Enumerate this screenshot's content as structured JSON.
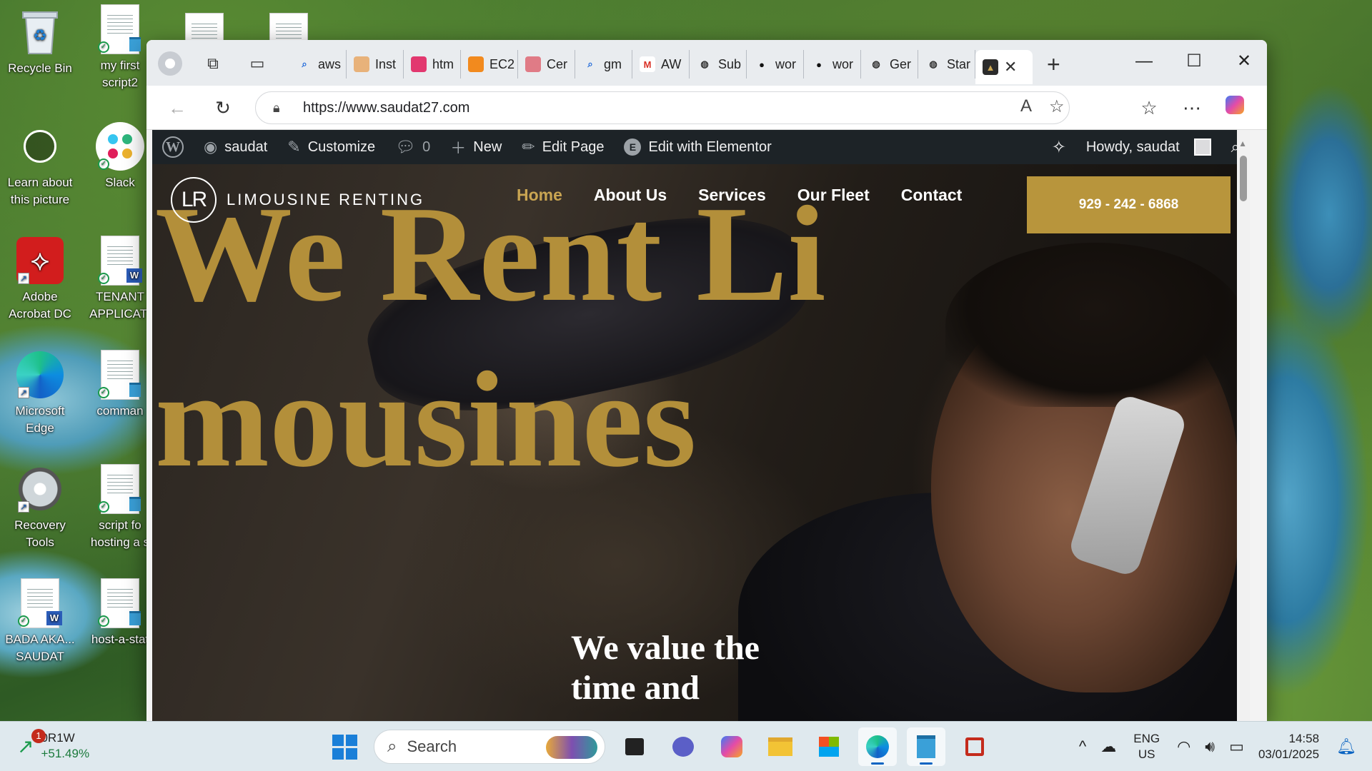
{
  "desktop": {
    "icons": [
      {
        "label": "Recycle Bin"
      },
      {
        "label": "my first\nscript2"
      },
      {
        "label": "Learn about\nthis picture"
      },
      {
        "label": "Slack"
      },
      {
        "label": "Adobe\nAcrobat DC"
      },
      {
        "label": "TENANT\nAPPLICATI"
      },
      {
        "label": "Microsoft\nEdge"
      },
      {
        "label": "comman"
      },
      {
        "label": "Recovery\nTools"
      },
      {
        "label": "script fo\nhosting a s"
      },
      {
        "label": "BADA AKA...\nSAUDAT"
      },
      {
        "label": "host-a-stat"
      }
    ]
  },
  "browser": {
    "tabs": [
      {
        "label": "aws",
        "icon": "search-icon",
        "color": "#e9ecef"
      },
      {
        "label": "Inst",
        "icon": "instance-icon",
        "color": "#e8b27a"
      },
      {
        "label": "htm",
        "icon": "html-icon",
        "color": "#e2386f"
      },
      {
        "label": "EC2",
        "icon": "ec2-icon",
        "color": "#f28a1e"
      },
      {
        "label": "Cer",
        "icon": "cert-icon",
        "color": "#e07b86"
      },
      {
        "label": "gm",
        "icon": "search-icon",
        "color": "#e9ecef"
      },
      {
        "label": "AW",
        "icon": "gmail-icon",
        "color": "#ffffff"
      },
      {
        "label": "Sub",
        "icon": "globe-icon",
        "color": "#e9ecef"
      },
      {
        "label": "wor",
        "icon": "github-icon",
        "color": "#e9ecef"
      },
      {
        "label": "wor",
        "icon": "github-icon",
        "color": "#e9ecef"
      },
      {
        "label": "Ger",
        "icon": "globe-icon",
        "color": "#e9ecef"
      },
      {
        "label": "Star",
        "icon": "globe-icon",
        "color": "#e9ecef"
      }
    ],
    "url": "https://www.saudat27.com"
  },
  "wpbar": {
    "site": "saudat",
    "customize": "Customize",
    "comments": "0",
    "new": "New",
    "edit_page": "Edit Page",
    "elementor": "Edit with Elementor",
    "howdy": "Howdy, saudat"
  },
  "site": {
    "logo_mark": "LR",
    "logo_text": "LIMOUSINE RENTING",
    "nav": [
      "Home",
      "About Us",
      "Services",
      "Our Fleet",
      "Contact"
    ],
    "phone": "929 - 242 - 6868",
    "headline": "We Rent Limousines",
    "subhead": "We value the time and"
  },
  "taskbar": {
    "stock_name": "0R1W",
    "stock_change": "+51.49%",
    "stock_badge": "1",
    "search": "Search",
    "lang1": "ENG",
    "lang2": "US",
    "time": "14:58",
    "date": "03/01/2025"
  },
  "colors": {
    "gold": "#b38f3a",
    "nav_active": "#c9a552",
    "button": "#b8953c",
    "wp_bar": "#1d2327"
  }
}
